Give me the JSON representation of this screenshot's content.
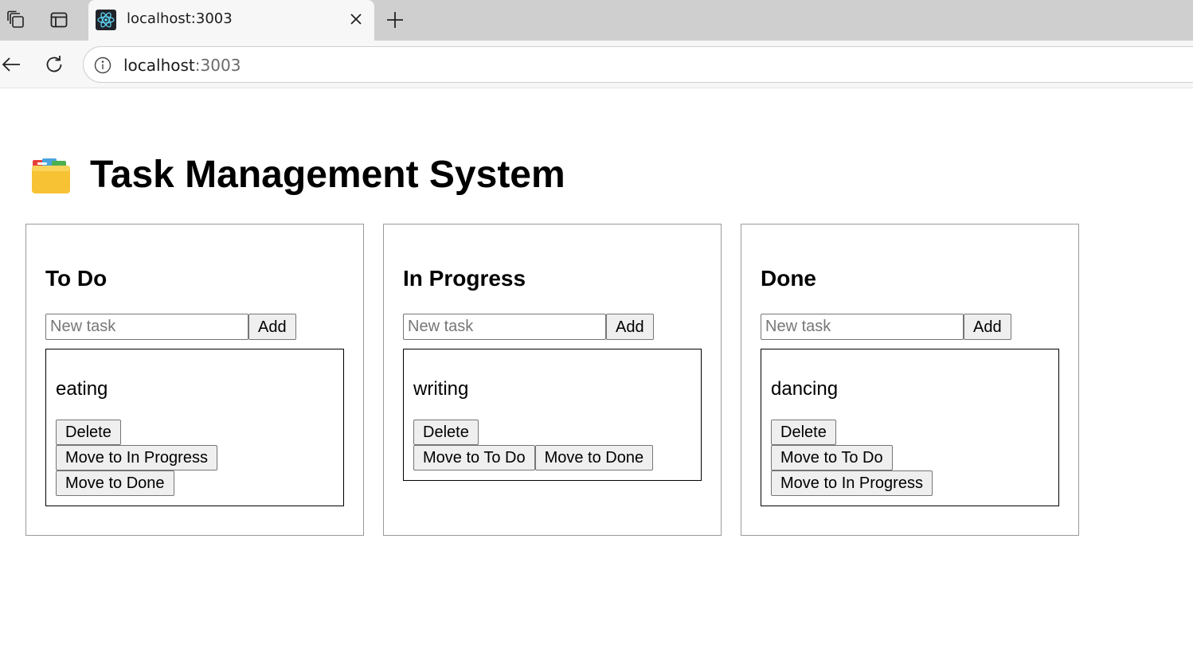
{
  "browser": {
    "tab_title": "localhost:3003",
    "url_host": "localhost",
    "url_port": ":3003",
    "icons": [
      "workspaces-icon",
      "tab-actions-icon",
      "react-favicon-icon",
      "close-icon",
      "new-tab-icon",
      "back-icon",
      "refresh-icon",
      "site-info-icon"
    ]
  },
  "page": {
    "title": "Task Management System",
    "title_emoji": "card-index-dividers-icon"
  },
  "columns": [
    {
      "title": "To Do",
      "input_placeholder": "New task",
      "add_label": "Add",
      "tasks": [
        {
          "name": "eating",
          "delete_label": "Delete",
          "moves": [
            "Move to In Progress",
            "Move to Done"
          ]
        }
      ]
    },
    {
      "title": "In Progress",
      "input_placeholder": "New task",
      "add_label": "Add",
      "tasks": [
        {
          "name": "writing",
          "delete_label": "Delete",
          "moves": [
            "Move to To Do",
            "Move to Done"
          ]
        }
      ]
    },
    {
      "title": "Done",
      "input_placeholder": "New task",
      "add_label": "Add",
      "tasks": [
        {
          "name": "dancing",
          "delete_label": "Delete",
          "moves": [
            "Move to To Do",
            "Move to In Progress"
          ]
        }
      ]
    }
  ]
}
